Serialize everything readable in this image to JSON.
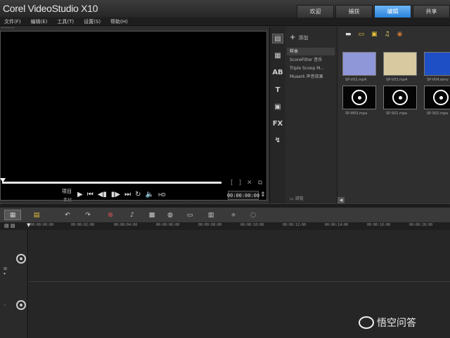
{
  "app": {
    "title": "Corel VideoStudio X10"
  },
  "tabs": [
    {
      "label": "欢迎",
      "active": false
    },
    {
      "label": "捕获",
      "active": false
    },
    {
      "label": "编辑",
      "active": true
    },
    {
      "label": "共享",
      "active": false
    }
  ],
  "menu": [
    "文件(F)",
    "编辑(E)",
    "工具(T)",
    "设置(S)",
    "帮助(H)"
  ],
  "preview": {
    "project_label": "项目",
    "clip_label": "素材",
    "hd_label": "HD",
    "timecode": "00:00:00:00"
  },
  "library": {
    "add_label": "添加",
    "folders": [
      "样本",
      "ScoreFitter 音乐",
      "Triple Scoop M...",
      "Muserk 声音效果"
    ],
    "browse_label": "浏览",
    "thumbnails": [
      {
        "caption": "SP-V02.mp4",
        "kind": "video",
        "color": "#8f97d8"
      },
      {
        "caption": "SP-V03.mp4",
        "kind": "video",
        "color": "#d9c9a0"
      },
      {
        "caption": "SP-V04.wmv",
        "kind": "video",
        "color": "#1f4fc4"
      },
      {
        "caption": "SP-M03.mpa",
        "kind": "music",
        "color": "#050505"
      },
      {
        "caption": "SP-S01.mpa",
        "kind": "music",
        "color": "#050505"
      },
      {
        "caption": "SP-S02.mpa",
        "kind": "music",
        "color": "#050505"
      }
    ]
  },
  "timeline": {
    "ruler": [
      "00:00:00:00",
      "00:00:02:00",
      "00:00:04:00",
      "00:00:06:00",
      "00:00:08:00",
      "00:00:10:00",
      "00:00:12:00",
      "00:00:14:00",
      "00:00:16:00",
      "00:00:18:00"
    ]
  },
  "watermark": {
    "text": "悟空问答"
  },
  "colors": {
    "accent": "#2b82d9",
    "background": "#2b2b2b"
  }
}
